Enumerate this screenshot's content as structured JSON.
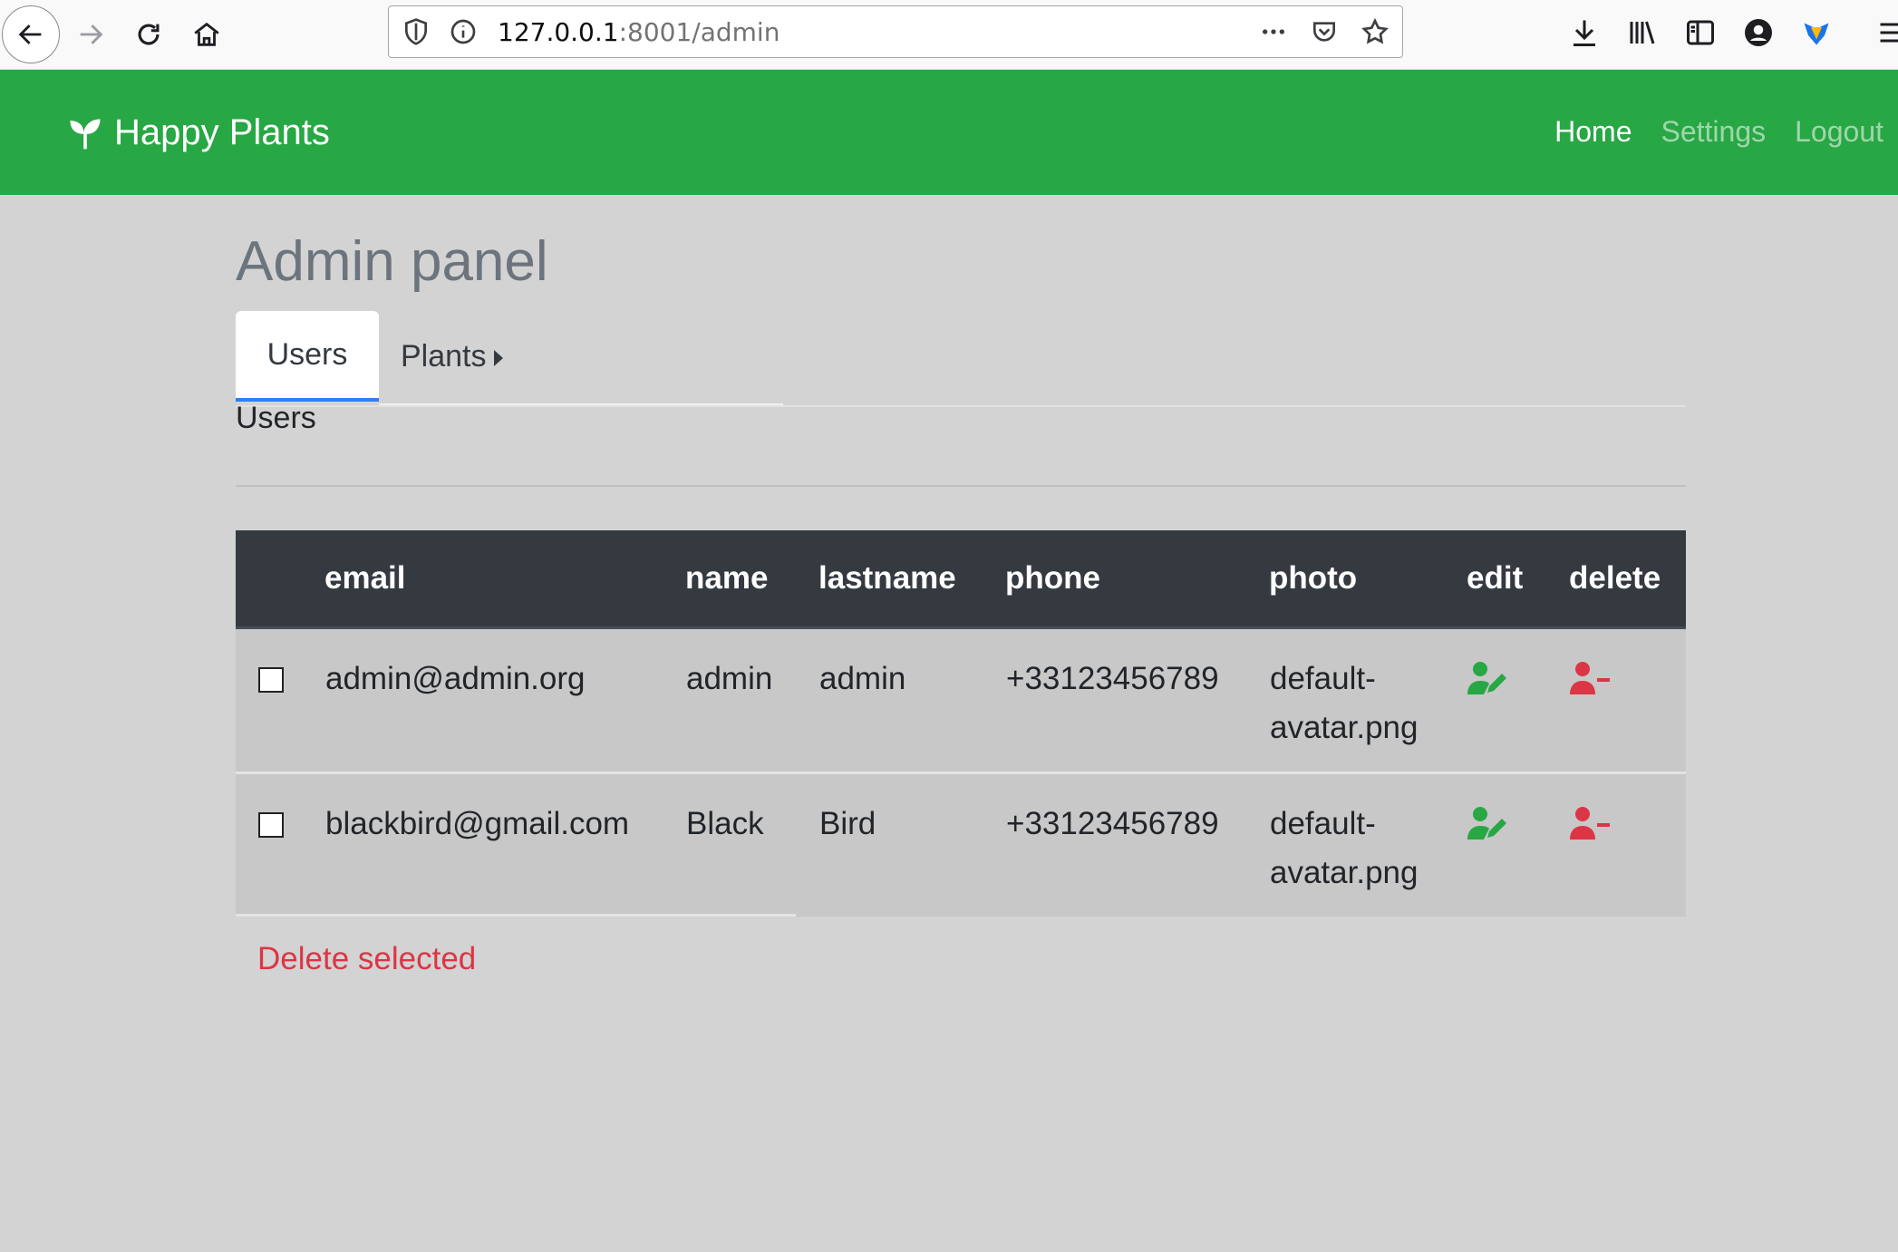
{
  "browser": {
    "url_host": "127.0.0.1",
    "url_rest": ":8001/admin"
  },
  "navbar": {
    "brand": "Happy Plants",
    "links": [
      "Home",
      "Settings",
      "Logout"
    ],
    "active": "Home"
  },
  "page": {
    "title": "Admin panel",
    "tabs": [
      {
        "label": "Users",
        "active": true
      },
      {
        "label": "Plants",
        "active": false
      }
    ],
    "section_title": "Users"
  },
  "table": {
    "headers": [
      "",
      "email",
      "name",
      "lastname",
      "phone",
      "photo",
      "edit",
      "delete"
    ],
    "rows": [
      {
        "email": "admin@admin.org",
        "name": "admin",
        "lastname": "admin",
        "phone": "+33123456789",
        "photo_line1": "default-",
        "photo_line2": "avatar.png"
      },
      {
        "email": "blackbird@gmail.com",
        "name": "Black",
        "lastname": "Bird",
        "phone": "+33123456789",
        "photo_line1": "default-",
        "photo_line2": "avatar.png"
      }
    ]
  },
  "actions": {
    "delete_selected": "Delete selected"
  },
  "colors": {
    "navbar": "#28a745",
    "edit_icon": "#28a745",
    "delete_icon": "#dc3545",
    "table_header": "#343a40"
  }
}
